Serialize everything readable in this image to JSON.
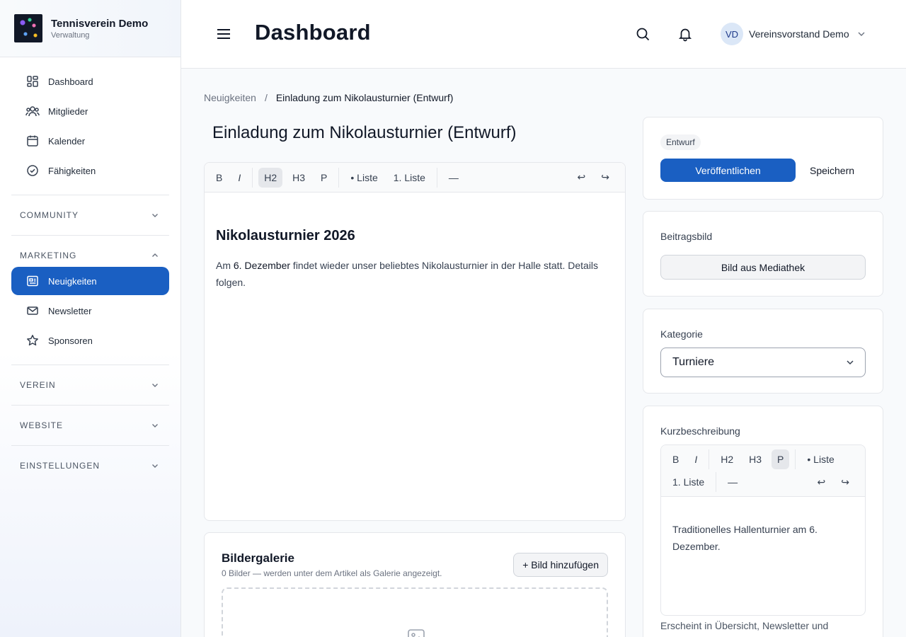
{
  "brand": {
    "name": "Tennisverein Demo",
    "subtitle": "Verwaltung"
  },
  "sidebar": {
    "items": [
      {
        "label": "Dashboard",
        "icon": "dashboard-icon"
      },
      {
        "label": "Mitglieder",
        "icon": "members-icon"
      },
      {
        "label": "Kalender",
        "icon": "calendar-icon"
      },
      {
        "label": "Fähigkeiten",
        "icon": "check-circle-icon"
      }
    ],
    "sections": {
      "community": "COMMUNITY",
      "marketing": "MARKETING",
      "verein": "VEREIN",
      "website": "WEBSITE",
      "einstellungen": "EINSTELLUNGEN"
    },
    "marketing_items": [
      {
        "label": "Neuigkeiten",
        "icon": "newspaper-icon",
        "active": true
      },
      {
        "label": "Newsletter",
        "icon": "mail-icon"
      },
      {
        "label": "Sponsoren",
        "icon": "star-icon"
      }
    ]
  },
  "header": {
    "title": "Dashboard",
    "user": {
      "initials": "VD",
      "name": "Vereinsvorstand Demo"
    }
  },
  "breadcrumb": {
    "parent": "Neuigkeiten",
    "separator": "/",
    "current": "Einladung zum Nikolausturnier (Entwurf)"
  },
  "article": {
    "title": "Einladung zum Nikolausturnier (Entwurf)",
    "toolbar": {
      "bold": "B",
      "italic": "I",
      "h2": "H2",
      "h3": "H3",
      "p": "P",
      "bullet_list": "• Liste",
      "ordered_list": "1. Liste",
      "rule": "—",
      "undo": "↩",
      "redo": "↪"
    },
    "heading": "Nikolausturnier 2026",
    "body_before": "Am ",
    "body_bold": "6. Dezember",
    "body_after": " findet wieder unser beliebtes Nikolausturnier in der Halle statt. Details folgen."
  },
  "gallery": {
    "title": "Bildergalerie",
    "subtitle": "0 Bilder — werden unter dem Artikel als Galerie angezeigt.",
    "add_button": "+ Bild hinzufügen"
  },
  "publish": {
    "status_badge": "Entwurf",
    "publish_button": "Veröffentlichen",
    "save_button": "Speichern"
  },
  "featured_image": {
    "label": "Beitragsbild",
    "button": "Bild aus Mediathek"
  },
  "category": {
    "label": "Kategorie",
    "selected": "Turniere"
  },
  "summary": {
    "label": "Kurzbeschreibung",
    "text": "Traditionelles Hallenturnier am 6. Dezember.",
    "hint": "Erscheint in Übersicht, Newsletter und"
  },
  "colors": {
    "primary": "#1a5fc2",
    "sidebar_bg": "#ffffff",
    "border": "#e5e7eb"
  }
}
